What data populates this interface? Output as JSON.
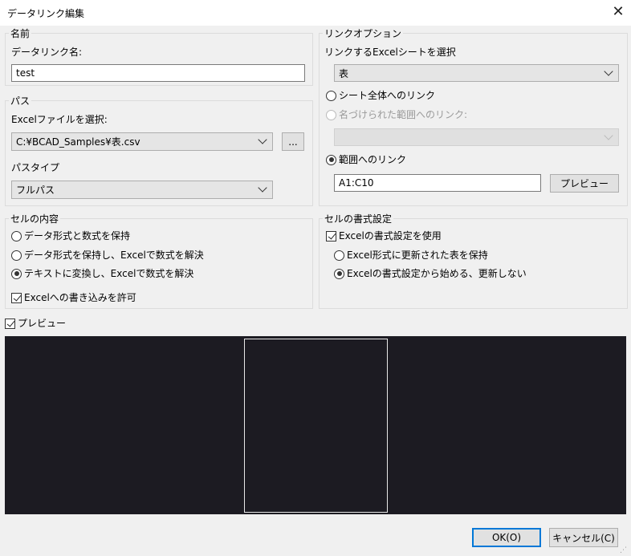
{
  "window": {
    "title": "データリンク編集"
  },
  "name_group": {
    "legend": "名前",
    "label": "データリンク名:",
    "value": "test"
  },
  "path_group": {
    "legend": "パス",
    "file_label": "Excelファイルを選択:",
    "file_value": "C:¥BCAD_Samples¥表.csv",
    "browse_label": "...",
    "type_label": "パスタイプ",
    "type_value": "フルパス"
  },
  "link_options": {
    "legend": "リンクオプション",
    "sheet_label": "リンクするExcelシートを選択",
    "sheet_value": "表",
    "whole_sheet": "シート全体へのリンク",
    "named_range": "名づけられた範囲へのリンク:",
    "named_range_value": "",
    "range": "範囲へのリンク",
    "range_value": "A1:C10",
    "preview_button": "プレビュー"
  },
  "cell_content": {
    "legend": "セルの内容",
    "opt1": "データ形式と数式を保持",
    "opt2": "データ形式を保持し、Excelで数式を解決",
    "opt3": "テキストに変換し、Excelで数式を解決",
    "allow_write": "Excelへの書き込みを許可"
  },
  "cell_format": {
    "legend": "セルの書式設定",
    "use_excel_format": "Excelの書式設定を使用",
    "opt1": "Excel形式に更新された表を保持",
    "opt2": "Excelの書式設定から始める、更新しない"
  },
  "preview_toggle": "プレビュー",
  "footer": {
    "ok": "OK(O)",
    "cancel": "キャンセル(C)"
  },
  "icons": {
    "close": "close-icon",
    "dropdown": "chevron-down-icon",
    "resize": "resize-grip-icon"
  }
}
